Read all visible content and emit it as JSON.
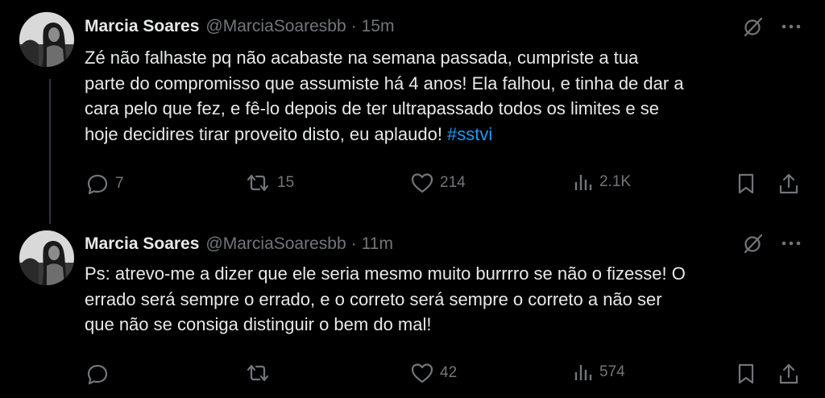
{
  "tweets": [
    {
      "author_name": "Marcia Soares",
      "author_handle": "@MarciaSoaresbb",
      "separator": "·",
      "time": "15m",
      "text_main": "Zé não falhaste pq não acabaste na semana passada, cumpriste a tua\nparte do compromisso que assumiste há 4 anos! Ela falhou, e tinha de dar a\ncara pelo que fez, e fê-lo depois de ter ultrapassado todos os limites e se\nhoje decidires tirar proveito disto, eu aplaudo! ",
      "hashtag": "#sstvi",
      "replies": "7",
      "retweets": "15",
      "likes": "214",
      "views": "2.1K"
    },
    {
      "author_name": "Marcia Soares",
      "author_handle": "@MarciaSoaresbb",
      "separator": "·",
      "time": "11m",
      "text_main": "Ps: atrevo-me a dizer que ele seria mesmo muito burrrro se não o fizesse! O\nerrado será sempre o errado, e o correto será sempre o correto a não ser\nque não se consiga distinguir o bem do mal!",
      "replies": "",
      "retweets": "",
      "likes": "42",
      "views": "574"
    }
  ],
  "icons": {
    "grok": "grok-slash-icon",
    "more": "more-dots-icon",
    "reply": "reply-bubble-icon",
    "retweet": "retweet-arrows-icon",
    "like": "heart-icon",
    "views": "views-bars-icon",
    "bookmark": "bookmark-icon",
    "share": "share-upload-icon"
  },
  "colors": {
    "background": "#000000",
    "text": "#e7e9ea",
    "muted": "#71767b",
    "link": "#1d9bf0"
  }
}
